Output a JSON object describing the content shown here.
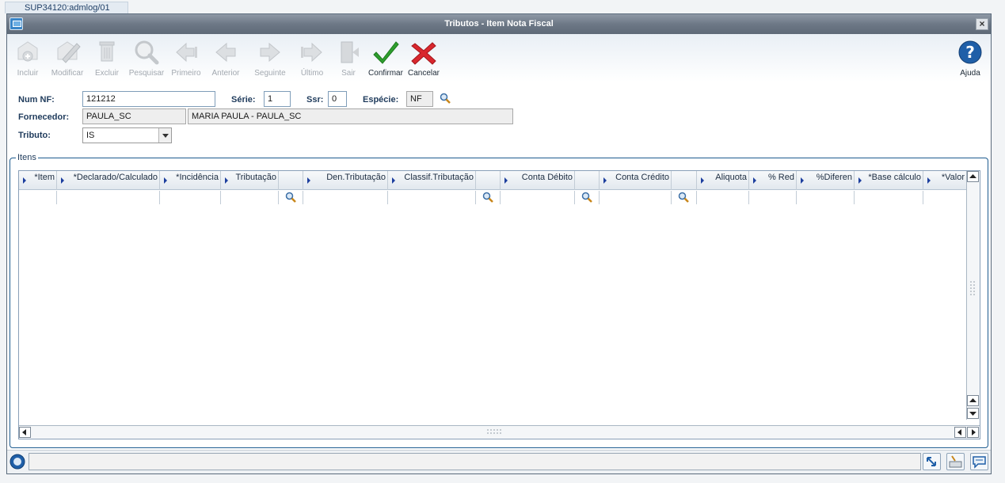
{
  "session_tab": "SUP34120:admlog/01",
  "window": {
    "title": "Tributos - Item Nota Fiscal"
  },
  "toolbar": {
    "incluir": "Incluir",
    "modificar": "Modificar",
    "excluir": "Excluir",
    "pesquisar": "Pesquisar",
    "primeiro": "Primeiro",
    "anterior": "Anterior",
    "seguinte": "Seguinte",
    "ultimo": "Último",
    "sair": "Sair",
    "confirmar": "Confirmar",
    "cancelar": "Cancelar",
    "ajuda": "Ajuda"
  },
  "form": {
    "num_nf_label": "Num NF:",
    "num_nf_value": "121212",
    "serie_label": "Série:",
    "serie_value": "1",
    "ssr_label": "Ssr:",
    "ssr_value": "0",
    "especie_label": "Espécie:",
    "especie_value": "NF",
    "fornecedor_label": "Fornecedor:",
    "fornecedor_code": "PAULA_SC",
    "fornecedor_name": "MARIA PAULA - PAULA_SC",
    "tributo_label": "Tributo:",
    "tributo_value": "IS"
  },
  "grid": {
    "group_title": "Itens",
    "columns": [
      "*Item",
      "*Declarado/Calculado",
      "*Incidência",
      "Tributação",
      "",
      "Den.Tributação",
      "Classif.Tributação",
      "",
      "Conta Débito",
      "",
      "Conta Crédito",
      "",
      "Aliquota",
      "% Red",
      "%Diferen",
      "*Base cálculo",
      "*Valor"
    ]
  },
  "colors": {
    "titlebar": "#6d7886",
    "label_text": "#1f3b5c",
    "confirm_green": "#2e9e2e",
    "cancel_red": "#d9272e",
    "help_blue": "#1f5fa8",
    "group_border": "#1d5b8f"
  }
}
